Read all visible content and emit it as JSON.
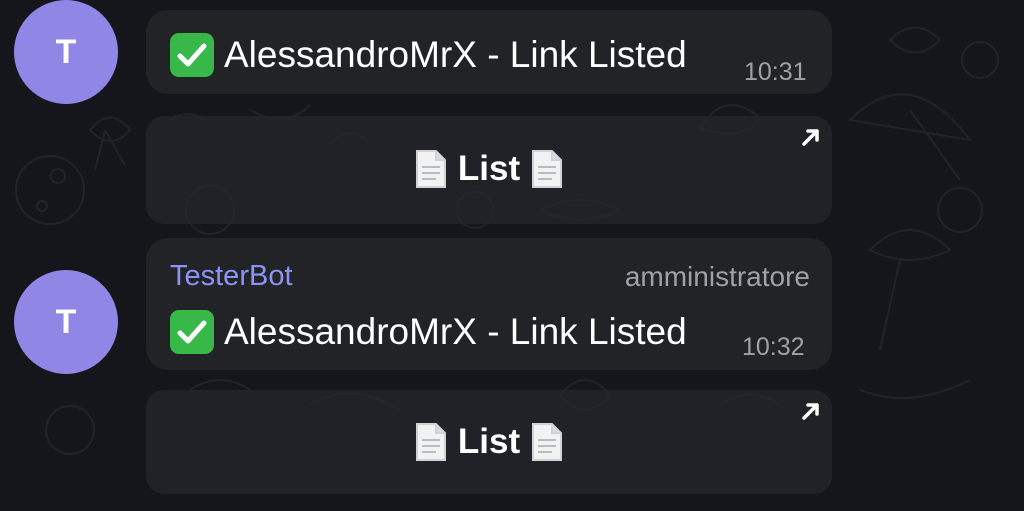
{
  "theme": {
    "avatar_color": "#8f86e6",
    "sender_color": "#8d93f5",
    "check_color": "#39b84a"
  },
  "messages": [
    {
      "avatar_initial": "T",
      "sender": "",
      "role": "",
      "text": "AlessandroMrX - Link Listed",
      "time": "10:31",
      "button_label": "List",
      "icons": [
        "check-icon",
        "document-icon",
        "external-link-arrow-icon"
      ]
    },
    {
      "avatar_initial": "T",
      "sender": "TesterBot",
      "role": "amministratore",
      "text": "AlessandroMrX - Link Listed",
      "time": "10:32",
      "button_label": "List",
      "icons": [
        "check-icon",
        "document-icon",
        "external-link-arrow-icon"
      ]
    }
  ]
}
